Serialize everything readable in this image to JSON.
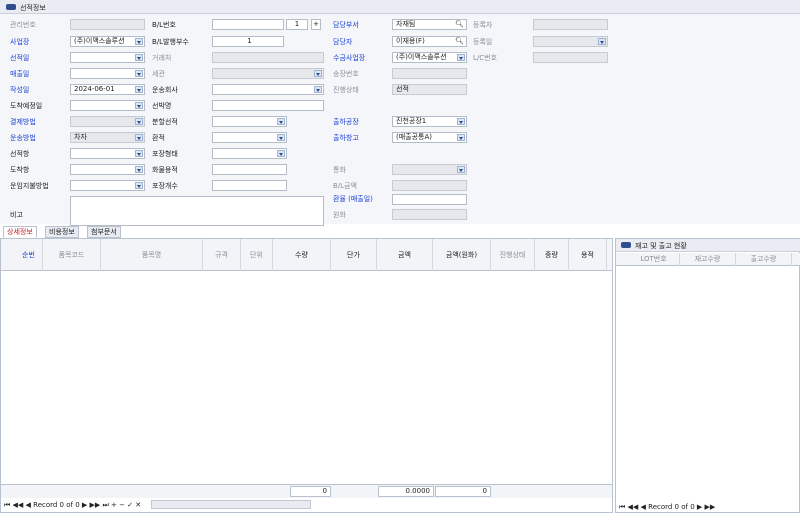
{
  "header": {
    "title": "선적정보"
  },
  "form": {
    "mgmt_no": {
      "label": "관리번호",
      "value": ""
    },
    "bl_no": {
      "label": "B/L번호",
      "value": "",
      "count": "1",
      "plus": "+"
    },
    "dept": {
      "label": "담당부서",
      "value": "자재팀"
    },
    "reg_user": {
      "label": "등록자",
      "value": ""
    },
    "biz": {
      "label": "사업장",
      "value": "(주)이맥스솔루션"
    },
    "bl_copies": {
      "label": "B/L발행부수",
      "value": "1"
    },
    "manager": {
      "label": "담당자",
      "value": "이재용(F)"
    },
    "reg_date": {
      "label": "등록일",
      "value": ""
    },
    "ship_date": {
      "label": "선적일",
      "value": ""
    },
    "customer": {
      "label": "거래처",
      "value": ""
    },
    "recv_biz": {
      "label": "수금사업장",
      "value": "(주)이맥스솔루션"
    },
    "lc_no": {
      "label": "L/C번호",
      "value": ""
    },
    "sale_date": {
      "label": "매출일",
      "value": ""
    },
    "customs": {
      "label": "세관",
      "value": ""
    },
    "invoice_no": {
      "label": "송장번호",
      "value": ""
    },
    "write_date": {
      "label": "작성일",
      "value": "2024-06-01"
    },
    "carrier": {
      "label": "운송회사",
      "value": ""
    },
    "status": {
      "label": "진행상태",
      "value": "선적"
    },
    "arrival": {
      "label": "도착예정일",
      "value": ""
    },
    "ship_name": {
      "label": "선박명",
      "value": ""
    },
    "pay_method": {
      "label": "결제방법",
      "value": ""
    },
    "split_ship": {
      "label": "분할선적",
      "value": ""
    },
    "out_factory": {
      "label": "출하공장",
      "value": "진천공장1"
    },
    "trans_method": {
      "label": "운송방법",
      "value": "차자"
    },
    "transship": {
      "label": "환적",
      "value": ""
    },
    "out_wh": {
      "label": "출하창고",
      "value": "(매출공통A)"
    },
    "ship_port": {
      "label": "선적항",
      "value": ""
    },
    "pack_type": {
      "label": "포장형태",
      "value": ""
    },
    "dest_port": {
      "label": "도착항",
      "value": ""
    },
    "cargo_vol": {
      "label": "화물용적",
      "value": ""
    },
    "currency": {
      "label": "통화",
      "value": ""
    },
    "freight_pay": {
      "label": "운임지불방법",
      "value": ""
    },
    "pkg_count": {
      "label": "포장개수",
      "value": ""
    },
    "bl_amount": {
      "label": "B/L금액",
      "value": ""
    },
    "remark": {
      "label": "비고",
      "value": ""
    },
    "fx_rate": {
      "label": "환율 (매출일)",
      "value": ""
    },
    "won": {
      "label": "원화",
      "value": ""
    }
  },
  "tabs": [
    "상세정보",
    "비용정보",
    "첨부문서"
  ],
  "grid": {
    "columns": [
      "순번",
      "품목코드",
      "품목명",
      "규격",
      "단위",
      "수량",
      "단가",
      "금액",
      "금액(원화)",
      "진행상태",
      "중량",
      "용적"
    ],
    "rows": [],
    "footer": {
      "qty": "0",
      "amount": "0.0000",
      "won_amount": "0"
    },
    "nav": "Record 0 of 0"
  },
  "right_panel": {
    "title": "재고 및 출고 현황",
    "columns": [
      "LOT번호",
      "재고수량",
      "출고수량"
    ],
    "nav": "Record 0 of 0"
  }
}
